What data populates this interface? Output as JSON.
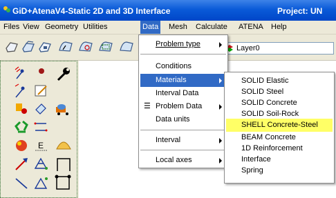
{
  "window": {
    "title": "GiD+AtenaV4-Static 2D and 3D Interface",
    "project_label": "Project: UN"
  },
  "menubar": {
    "items": [
      "Files",
      "View",
      "Geometry",
      "Utilities",
      "Data",
      "Mesh",
      "Calculate",
      "ATENA",
      "Help"
    ],
    "active": "Data"
  },
  "toolbar": {
    "layer_value": "Layer0",
    "layer_color": "#00aa00"
  },
  "data_menu": {
    "problem_type": "Problem type",
    "conditions": "Conditions",
    "materials": "Materials",
    "interval_data": "Interval Data",
    "problem_data": "Problem Data",
    "data_units": "Data units",
    "interval": "Interval",
    "local_axes": "Local axes"
  },
  "materials_menu": {
    "items": [
      "SOLID Elastic",
      "SOLID Steel",
      "SOLID Concrete",
      "SOLID Soil-Rock",
      "SHELL Concrete-Steel",
      "BEAM Concrete",
      "1D Reinforcement",
      "Interface",
      "Spring"
    ],
    "highlighted": "SHELL Concrete-Steel"
  },
  "colors": {
    "title_blue": "#0a5ad8",
    "menu_highlight": "#316ac5",
    "submenu_highlight": "#ffff66",
    "chrome": "#ece9d8"
  }
}
